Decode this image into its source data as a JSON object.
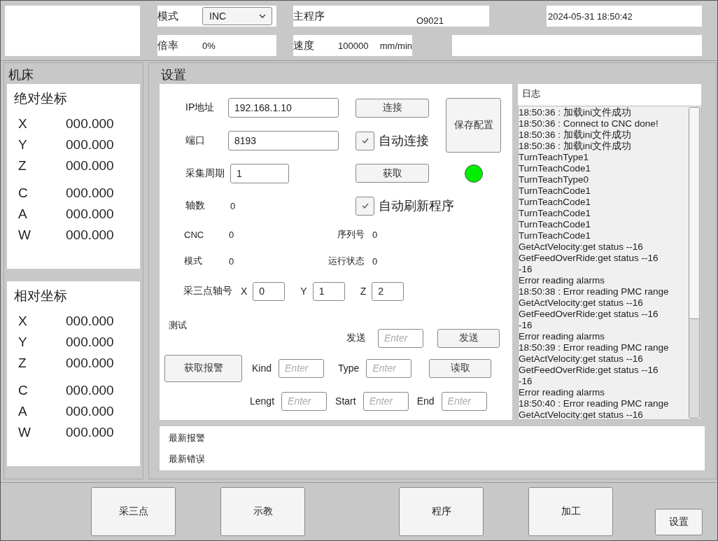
{
  "header": {
    "mode_label": "模式",
    "mode_value": "INC",
    "main_program_label": "主程序",
    "program_number": "O9021",
    "datetime": "2024-05-31 18:50:42",
    "rate_label": "倍率",
    "rate_value": "0%",
    "speed_label": "速度",
    "speed_value": "100000",
    "speed_unit": "mm/min"
  },
  "machine": {
    "title": "机床",
    "cards": [
      {
        "title": "绝对坐标",
        "axis_groups": [
          [
            {
              "axis": "X",
              "value": "000.000"
            },
            {
              "axis": "Y",
              "value": "000.000"
            },
            {
              "axis": "Z",
              "value": "000.000"
            }
          ],
          [
            {
              "axis": "C",
              "value": "000.000"
            },
            {
              "axis": "A",
              "value": "000.000"
            },
            {
              "axis": "W",
              "value": "000.000"
            }
          ]
        ]
      },
      {
        "title": "相对坐标",
        "axis_groups": [
          [
            {
              "axis": "X",
              "value": "000.000"
            },
            {
              "axis": "Y",
              "value": "000.000"
            },
            {
              "axis": "Z",
              "value": "000.000"
            }
          ],
          [
            {
              "axis": "C",
              "value": "000.000"
            },
            {
              "axis": "A",
              "value": "000.000"
            },
            {
              "axis": "W",
              "value": "000.000"
            }
          ]
        ]
      }
    ]
  },
  "settings": {
    "title": "设置",
    "ip": {
      "label": "IP地址",
      "value": "192.168.1.10"
    },
    "port": {
      "label": "端口",
      "value": "8193"
    },
    "period": {
      "label": "采集周期",
      "value": "1"
    },
    "connect_button": "连接",
    "fetch_button": "获取",
    "save_button": "保存配置",
    "auto_connect": {
      "label": "自动连接",
      "checked": true
    },
    "auto_refresh": {
      "label": "自动刷新程序",
      "checked": true
    },
    "connected": true,
    "axis_count": {
      "label": "轴数",
      "value": "0"
    },
    "cnc": {
      "label": "CNC",
      "value": "0"
    },
    "serial": {
      "label": "序列号",
      "value": "0"
    },
    "mode": {
      "label": "模式",
      "value": "0"
    },
    "run_state": {
      "label": "运行状态",
      "value": "0"
    },
    "pick_axes": {
      "label": "采三点轴号",
      "fields": [
        {
          "label": "X",
          "value": "0"
        },
        {
          "label": "Y",
          "value": "1"
        },
        {
          "label": "Z",
          "value": "2"
        }
      ]
    },
    "test": {
      "title": "测试",
      "send_label": "发送",
      "send_placeholder": "Enter",
      "send_button": "发送",
      "alarm_button": "获取报警",
      "kind_label": "Kind",
      "kind_placeholder": "Enter",
      "type_label": "Type",
      "type_placeholder": "Enter",
      "read_button": "读取",
      "length_label": "Lengt",
      "length_placeholder": "Enter",
      "start_label": "Start",
      "start_placeholder": "Enter",
      "end_label": "End",
      "end_placeholder": "Enter"
    },
    "log": {
      "title": "日志",
      "lines": [
        "18:50:36  : 加载ini文件成功",
        "18:50:36  : Connect to CNC done!",
        "18:50:36  : 加载ini文件成功",
        "18:50:36  : 加载ini文件成功",
        "TurnTeachType1",
        "TurnTeachCode1",
        "TurnTeachType0",
        "TurnTeachCode1",
        "TurnTeachCode1",
        "TurnTeachCode1",
        "TurnTeachCode1",
        "TurnTeachCode1",
        "GetActVelocity:get status --16",
        "GetFeedOverRide:get status --16",
        "-16",
        "Error reading alarms",
        "18:50:38  : Error reading PMC range",
        "GetActVelocity:get status --16",
        "GetFeedOverRide:get status --16",
        "-16",
        "Error reading alarms",
        "18:50:39  : Error reading PMC range",
        "GetActVelocity:get status --16",
        "GetFeedOverRide:get status --16",
        "-16",
        "Error reading alarms",
        "18:50:40  : Error reading PMC range",
        "GetActVelocity:get status --16"
      ]
    }
  },
  "status": {
    "alarm_label": "最新报警",
    "error_label": "最新错误"
  },
  "nav_buttons": [
    {
      "label": "采三点",
      "kind": "large"
    },
    {
      "label": "示教",
      "kind": "large"
    },
    {
      "label": "程序",
      "kind": "large"
    },
    {
      "label": "加工",
      "kind": "large"
    },
    {
      "label": "设置",
      "kind": "small"
    }
  ]
}
